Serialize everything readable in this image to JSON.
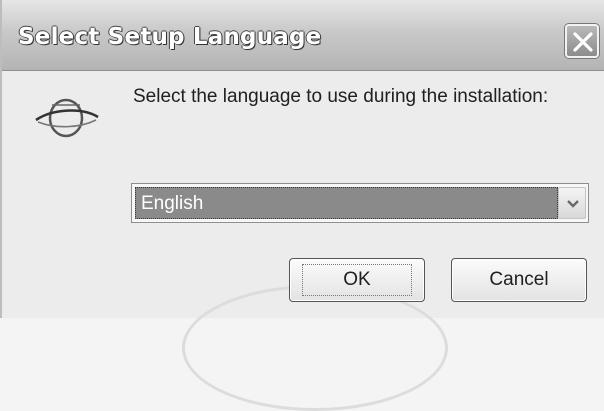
{
  "window": {
    "title": "Select Setup Language"
  },
  "dialog": {
    "prompt": "Select the language to use during the installation:",
    "language_select": {
      "selected": "English"
    },
    "ok_label": "OK",
    "cancel_label": "Cancel"
  },
  "icons": {
    "app": "globe-icon",
    "close": "close-icon",
    "dropdown": "chevron-down-icon"
  }
}
